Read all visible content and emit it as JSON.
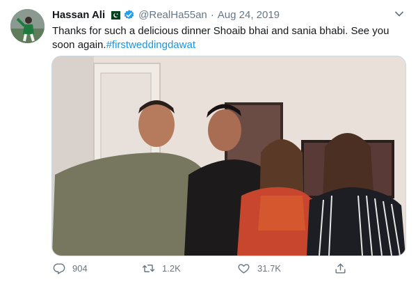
{
  "tweet": {
    "author_name": "Hassan Ali",
    "handle": "@RealHa55an",
    "separator": "·",
    "date": "Aug 24, 2019",
    "text": "Thanks for such a delicious dinner Shoaib bhai and sania bhabi. See you soon again.",
    "hashtag": "#firstweddingdawat"
  },
  "icons": {
    "flag": "pakistan-flag-icon",
    "verified": "verified-badge-icon",
    "caret": "chevron-down-icon",
    "reply": "reply-icon",
    "retweet": "retweet-icon",
    "like": "heart-icon",
    "share": "share-icon"
  },
  "actions": {
    "reply_count": "904",
    "retweet_count": "1.2K",
    "like_count": "31.7K"
  },
  "colors": {
    "link": "#1b95e0",
    "muted": "#657786",
    "verified": "#1da1f2"
  }
}
